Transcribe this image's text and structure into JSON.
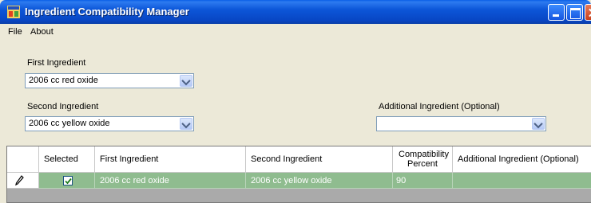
{
  "window": {
    "title": "Ingredient Compatibility Manager",
    "controls": [
      "minimize-icon",
      "maximize-icon",
      "close-icon"
    ]
  },
  "menu": {
    "items": [
      "File",
      "About"
    ]
  },
  "form": {
    "first_ingredient": {
      "label": "First Ingredient",
      "value": "2006 cc red oxide"
    },
    "second_ingredient": {
      "label": "Second Ingredient",
      "value": "2006 cc yellow oxide"
    },
    "additional_ingredient": {
      "label": "Additional Ingredient (Optional)",
      "value": ""
    }
  },
  "grid": {
    "columns": [
      "Selected",
      "First Ingredient",
      "Second Ingredient",
      "Compatibility Percent",
      "Additional Ingredient (Optional)"
    ],
    "rows": [
      {
        "selected": true,
        "first": "2006 cc red oxide",
        "second": "2006 cc yellow oxide",
        "percent": "90",
        "additional": ""
      }
    ],
    "row_highlight_color": "#8fbc8f"
  }
}
